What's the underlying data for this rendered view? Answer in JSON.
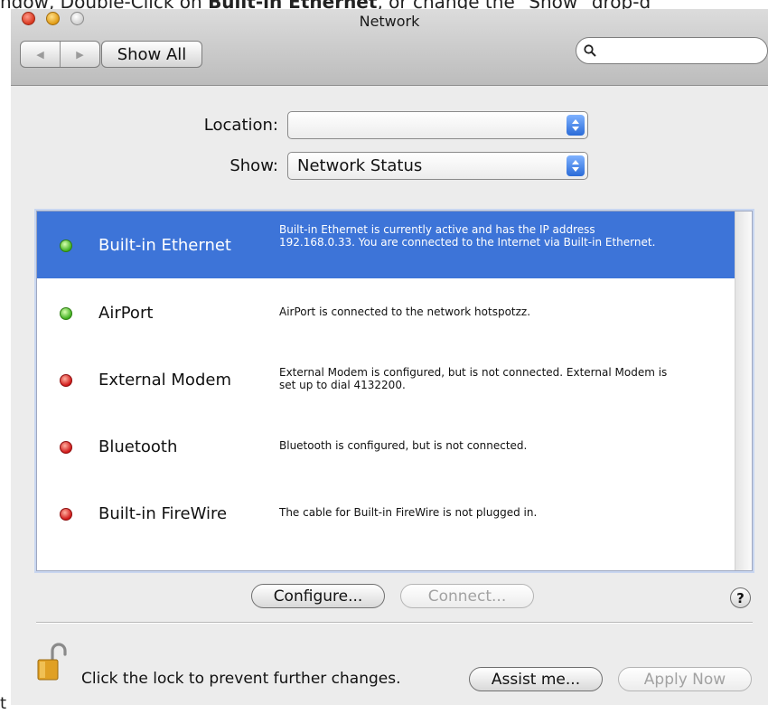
{
  "caption": {
    "top_before": "ndow, Double-Click on ",
    "top_bold": "Built-in Ethernet",
    "top_after": ", or change the \"Show\" drop-d",
    "bottom": "t"
  },
  "window": {
    "title": "Network"
  },
  "toolbar": {
    "back_glyph": "◀",
    "forward_glyph": "▶",
    "show_all_label": "Show All",
    "search_value": "",
    "search_icon": "magnifier-icon"
  },
  "form": {
    "location_label": "Location:",
    "location_value": "",
    "show_label": "Show:",
    "show_value": "Network Status"
  },
  "services": [
    {
      "name": "Built-in Ethernet",
      "status": "active",
      "selected": true,
      "description": "Built-in Ethernet is currently active and has the IP address 192.168.0.33. You are connected to the Internet via Built-in Ethernet."
    },
    {
      "name": "AirPort",
      "status": "active",
      "selected": false,
      "description": "AirPort is connected to the network hotspotzz."
    },
    {
      "name": "External Modem",
      "status": "inactive",
      "selected": false,
      "description": "External Modem is configured, but is not connected. External Modem is set up to dial 4132200."
    },
    {
      "name": "Bluetooth",
      "status": "inactive",
      "selected": false,
      "description": "Bluetooth is configured, but is not connected."
    },
    {
      "name": "Built-in FireWire",
      "status": "inactive",
      "selected": false,
      "description": "The cable for Built-in FireWire is not plugged in."
    }
  ],
  "actions": {
    "configure_label": "Configure...",
    "connect_label": "Connect...",
    "help_label": "?"
  },
  "footer": {
    "lock_text": "Click the lock to prevent further changes.",
    "assist_label": "Assist me...",
    "apply_label": "Apply Now"
  },
  "colors": {
    "selection": "#3d74d8",
    "status_active": "#40b020",
    "status_inactive": "#d01818"
  }
}
